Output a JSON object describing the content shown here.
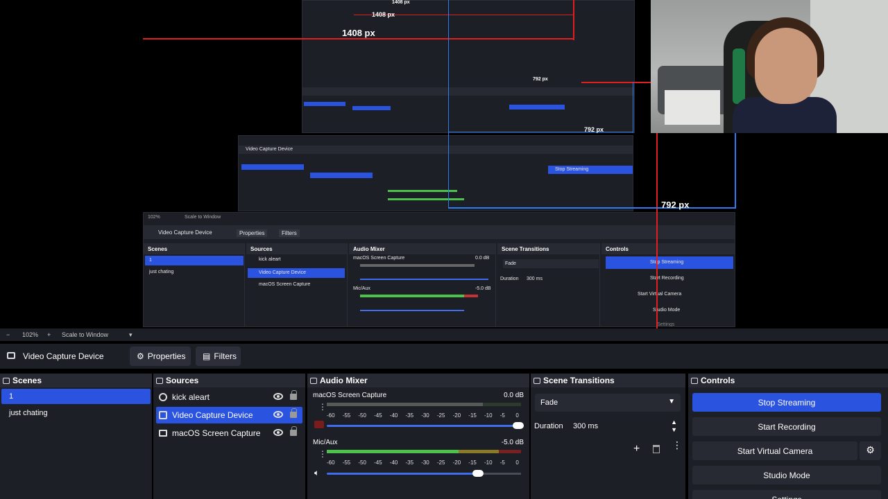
{
  "preview": {
    "measure_labels": [
      "1408 px",
      "1408 px",
      "1408 px",
      "792 px",
      "792 px",
      "792 px"
    ],
    "inner": {
      "zoom": "102%",
      "scale_label": "Scale to Window",
      "source_name": "Video Capture Device",
      "properties": "Properties",
      "filters": "Filters",
      "scenes_title": "Scenes",
      "scenes": [
        "1",
        "just chating"
      ],
      "sources_title": "Sources",
      "sources": [
        "kick aleart",
        "Video Capture Device",
        "macOS Screen Capture"
      ],
      "mixer_title": "Audio Mixer",
      "mixer_ch1": "macOS Screen Capture",
      "mixer_ch1_db": "0.0 dB",
      "mixer_ch2": "Mic/Aux",
      "mixer_ch2_db": "-5.0 dB",
      "transitions_title": "Scene Transitions",
      "transition": "Fade",
      "duration_label": "Duration",
      "duration": "300 ms",
      "controls_title": "Controls",
      "stop_streaming": "Stop Streaming",
      "start_recording": "Start Recording",
      "start_virtual": "Start Virtual Camera",
      "studio_mode": "Studio Mode",
      "settings": "Settings"
    }
  },
  "zoombar": {
    "minus": "−",
    "zoom": "102%",
    "plus": "+",
    "scale_mode": "Scale to Window",
    "chevron": "▾"
  },
  "context": {
    "source_name": "Video Capture Device",
    "properties": "Properties",
    "filters": "Filters"
  },
  "scenes": {
    "title": "Scenes",
    "items": [
      {
        "label": "1",
        "selected": true
      },
      {
        "label": "just chating",
        "selected": false
      }
    ]
  },
  "sources": {
    "title": "Sources",
    "items": [
      {
        "label": "kick aleart",
        "icon": "globe-icon",
        "selected": false
      },
      {
        "label": "Video Capture Device",
        "icon": "camera-icon",
        "selected": true
      },
      {
        "label": "macOS Screen Capture",
        "icon": "monitor-icon",
        "selected": false
      }
    ]
  },
  "mixer": {
    "title": "Audio Mixer",
    "scale_ticks": [
      "-60",
      "-55",
      "-50",
      "-45",
      "-40",
      "-35",
      "-30",
      "-25",
      "-20",
      "-15",
      "-10",
      "-5",
      "0"
    ],
    "channels": [
      {
        "name": "macOS Screen Capture",
        "db": "0.0 dB",
        "volume": 1.0,
        "muted": true
      },
      {
        "name": "Mic/Aux",
        "db": "-5.0 dB",
        "volume": 0.78,
        "muted": false
      }
    ]
  },
  "transitions": {
    "title": "Scene Transitions",
    "selected": "Fade",
    "duration_label": "Duration",
    "duration": "300 ms"
  },
  "controls": {
    "title": "Controls",
    "stop_streaming": "Stop Streaming",
    "start_recording": "Start Recording",
    "start_virtual_camera": "Start Virtual Camera",
    "studio_mode": "Studio Mode",
    "settings": "Settings"
  },
  "colors": {
    "accent": "#2a53e0",
    "panel": "#1d1f26",
    "header": "#272a33",
    "meter_green": "#4cc24c",
    "meter_yellow": "#c9b233",
    "meter_red": "#c83232"
  }
}
